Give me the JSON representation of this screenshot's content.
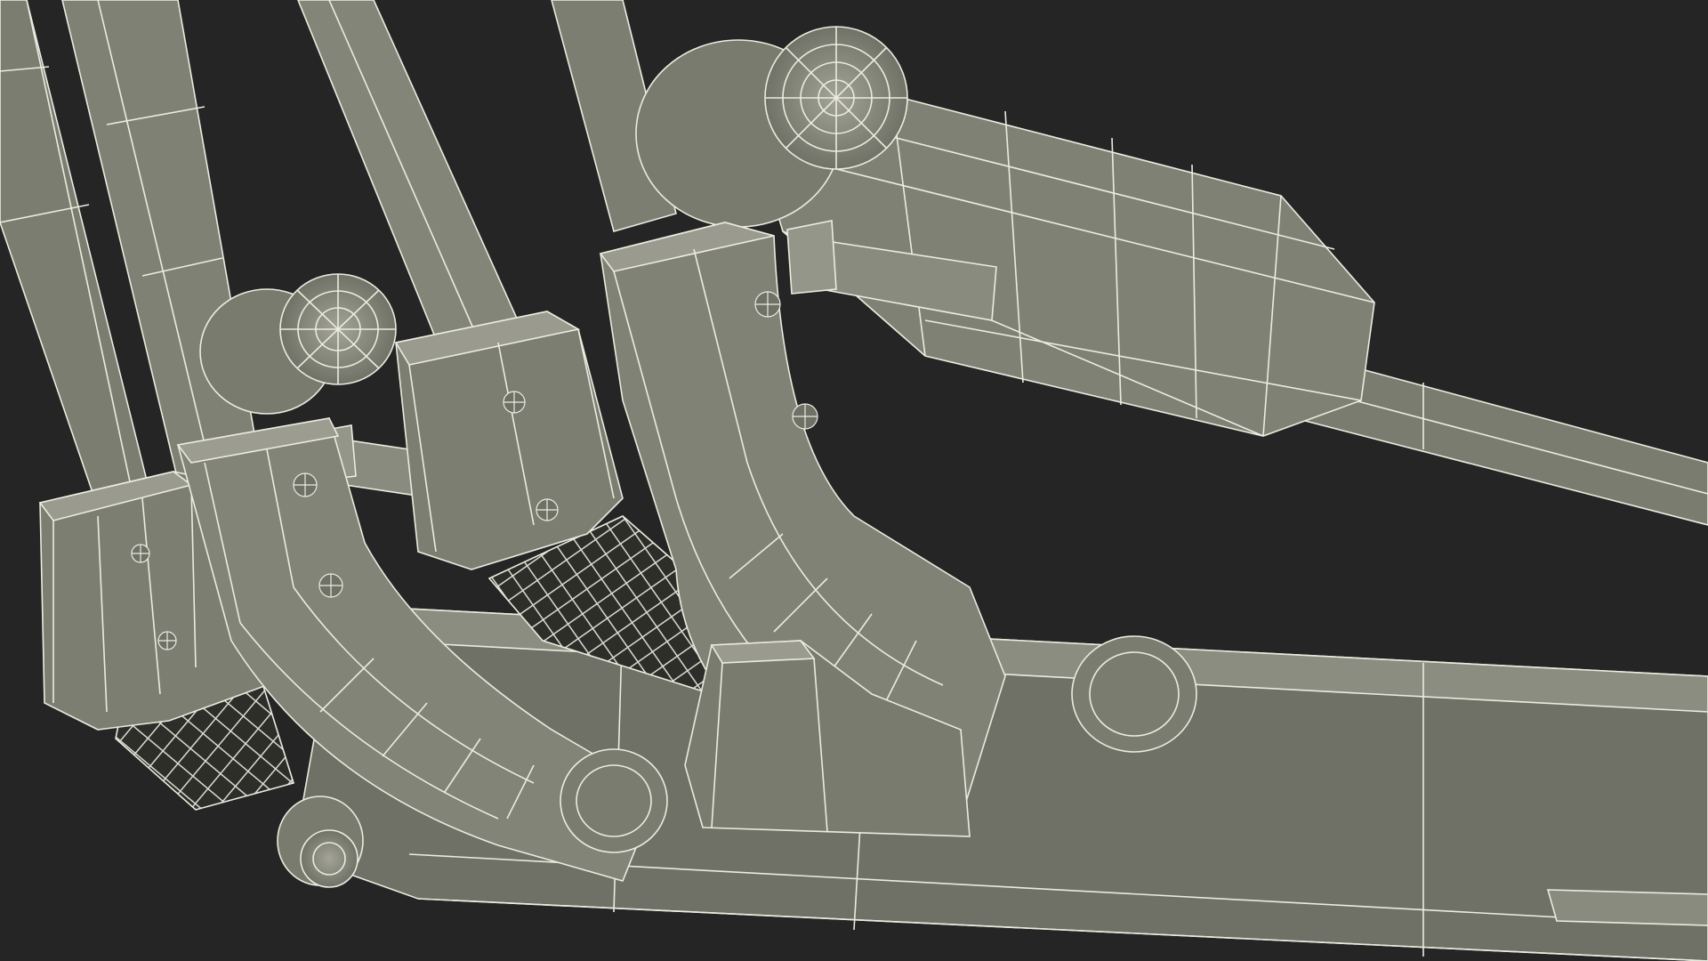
{
  "scene": {
    "background_color": "#252525",
    "surface_color": "#7f8074",
    "surface_light": "#9a9b8e",
    "surface_dark": "#5e5f55",
    "wire_color": "#e9ecdf"
  }
}
